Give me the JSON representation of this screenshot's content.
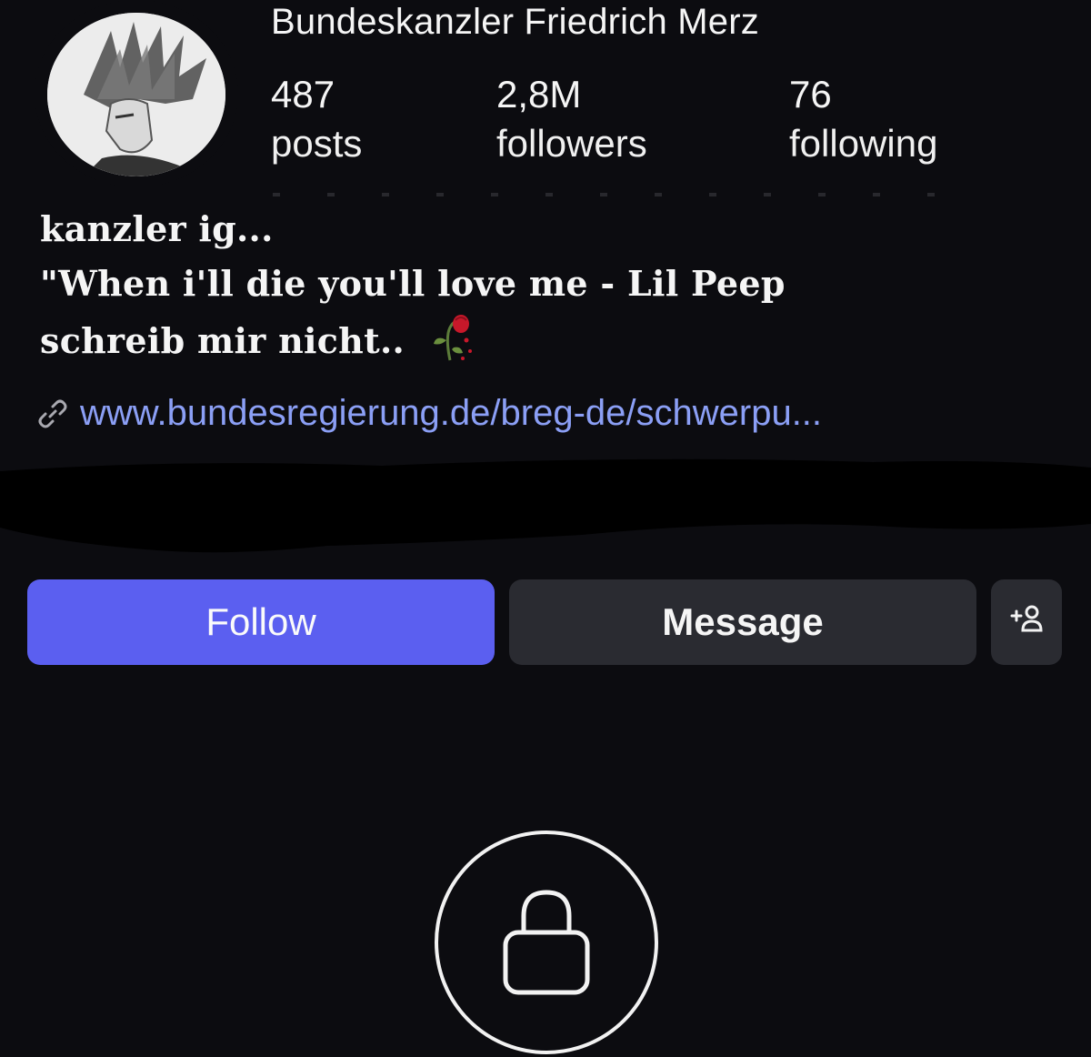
{
  "profile": {
    "username": "Bundeskanzler Friedrich Merz",
    "avatar_icon": "anime-character-avatar"
  },
  "stats": {
    "posts": {
      "value": "487",
      "label": "posts"
    },
    "followers": {
      "value": "2,8M",
      "label": "followers"
    },
    "following": {
      "value": "76",
      "label": "following"
    }
  },
  "bio": {
    "line1": "kanzler ig...",
    "line2": "\"When i'll die you'll love me - Lil Peep",
    "line3": "schreib mir nicht..",
    "emoji_icon": "wilted-rose-icon"
  },
  "link": {
    "icon": "link-icon",
    "text": "www.bundesregierung.de/breg-de/schwerpu..."
  },
  "actions": {
    "follow_label": "Follow",
    "message_label": "Message",
    "add_user_icon": "add-person-icon"
  },
  "private": {
    "icon": "lock-icon"
  },
  "colors": {
    "background": "#0c0c10",
    "follow_button": "#5b5ff0",
    "secondary_button": "#2a2b31",
    "link": "#8b9ff5",
    "text": "#f5f5f5"
  }
}
